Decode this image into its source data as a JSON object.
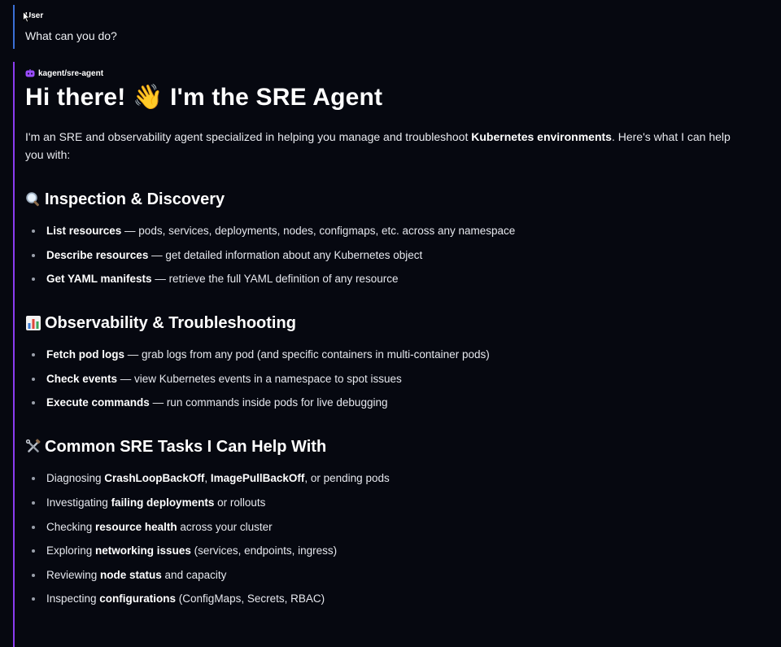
{
  "user": {
    "label": "User",
    "message": "What can you do?"
  },
  "agent": {
    "name": "kagent/sre-agent",
    "icon": "bot-icon",
    "heading": "Hi there! 👋 I'm the SRE Agent",
    "intro": {
      "before": "I'm an SRE and observability agent specialized in helping you manage and troubleshoot ",
      "bold": "Kubernetes environments",
      "after": ". Here's what I can help you with:"
    },
    "sections": [
      {
        "icon": "magnifier-icon",
        "title": "Inspection & Discovery",
        "items": [
          {
            "bold": "List resources",
            "text": " — pods, services, deployments, nodes, configmaps, etc. across any namespace"
          },
          {
            "bold": "Describe resources",
            "text": " — get detailed information about any Kubernetes object"
          },
          {
            "bold": "Get YAML manifests",
            "text": " — retrieve the full YAML definition of any resource"
          }
        ]
      },
      {
        "icon": "bar-chart-icon",
        "title": "Observability & Troubleshooting",
        "items": [
          {
            "bold": "Fetch pod logs",
            "text": " — grab logs from any pod (and specific containers in multi-container pods)"
          },
          {
            "bold": "Check events",
            "text": " — view Kubernetes events in a namespace to spot issues"
          },
          {
            "bold": "Execute commands",
            "text": " — run commands inside pods for live debugging"
          }
        ]
      },
      {
        "icon": "tools-icon",
        "title": "Common SRE Tasks I Can Help With",
        "items": [
          {
            "pre": "Diagnosing ",
            "bold": "CrashLoopBackOff",
            "mid": ", ",
            "bold2": "ImagePullBackOff",
            "post": ", or pending pods"
          },
          {
            "pre": "Investigating ",
            "bold": "failing deployments",
            "post": " or rollouts"
          },
          {
            "pre": "Checking ",
            "bold": "resource health",
            "post": " across your cluster"
          },
          {
            "pre": "Exploring ",
            "bold": "networking issues",
            "post": " (services, endpoints, ingress)"
          },
          {
            "pre": "Reviewing ",
            "bold": "node status",
            "post": " and capacity"
          },
          {
            "pre": "Inspecting ",
            "bold": "configurations",
            "post": " (ConfigMaps, Secrets, RBAC)"
          }
        ]
      }
    ]
  }
}
